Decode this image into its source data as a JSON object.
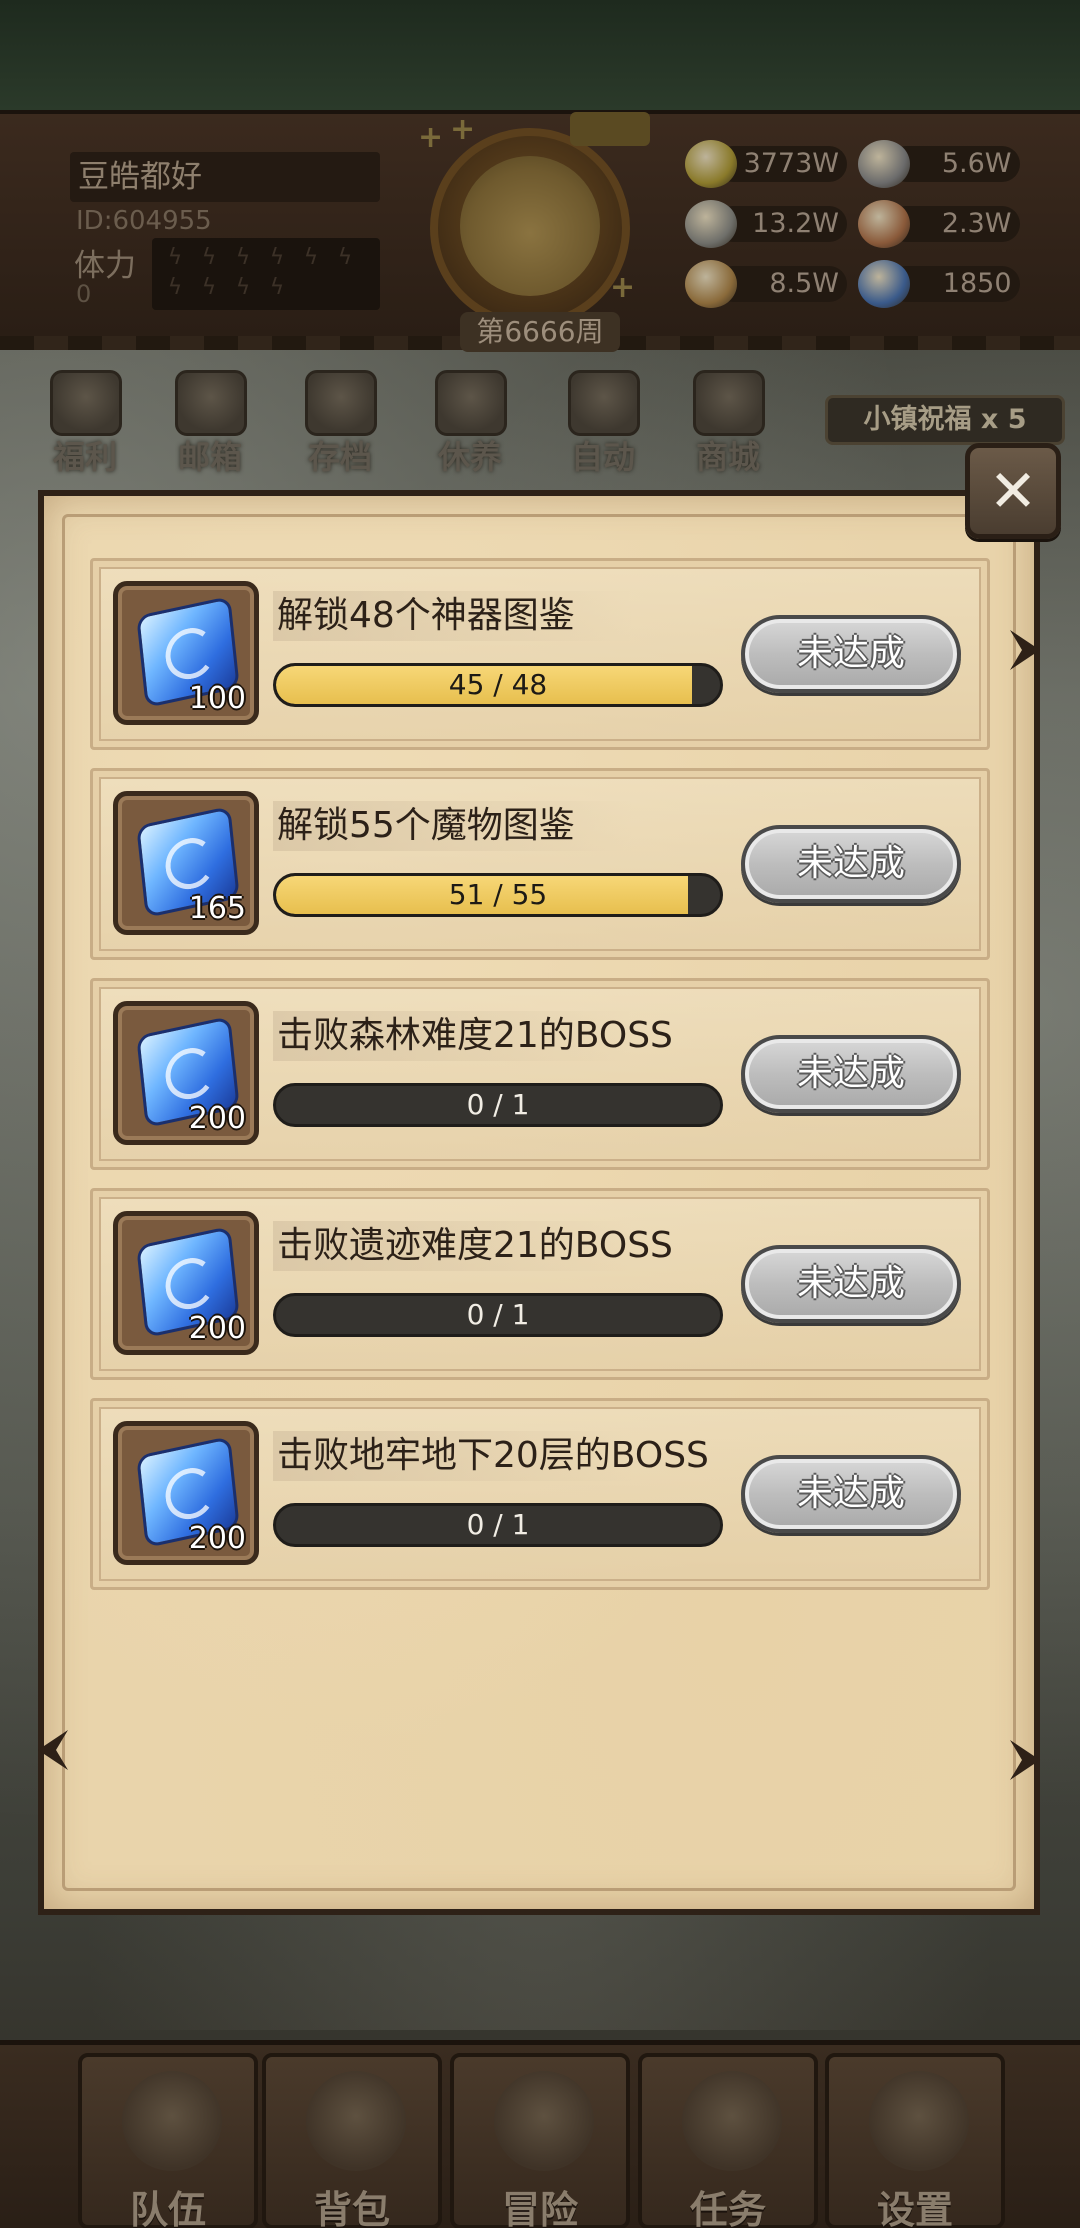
{
  "player": {
    "name": "豆皓都好",
    "id": "ID:604955",
    "stamina_label": "体力",
    "stamina_value": "0",
    "stamina_slots": 10,
    "badge": "",
    "week": "第6666周"
  },
  "resources": [
    {
      "icon": "gold-coin-icon",
      "value": "3773W",
      "color": "#8a7a2a"
    },
    {
      "icon": "iron-ingot-icon",
      "value": "5.6W",
      "color": "#6b6b6b"
    },
    {
      "icon": "ore-icon",
      "value": "13.2W",
      "color": "#6f6f6a"
    },
    {
      "icon": "leather-icon",
      "value": "2.3W",
      "color": "#8a5a3a"
    },
    {
      "icon": "wood-icon",
      "value": "8.5W",
      "color": "#8a6a3a"
    },
    {
      "icon": "blue-crystal-icon",
      "value": "1850",
      "color": "#3a5a8a"
    }
  ],
  "menu": [
    {
      "name": "welfare",
      "label": "福利"
    },
    {
      "name": "mailbox",
      "label": "邮箱"
    },
    {
      "name": "save",
      "label": "存档"
    },
    {
      "name": "rest",
      "label": "休养"
    },
    {
      "name": "auto",
      "label": "自动"
    },
    {
      "name": "shop",
      "label": "商城"
    }
  ],
  "blessing": "小镇祝福 x 5",
  "tasks": [
    {
      "title": "解锁48个神器图鉴",
      "reward": "100",
      "progress_text": "45 / 48",
      "progress": 0.9375,
      "status": "未达成"
    },
    {
      "title": "解锁55个魔物图鉴",
      "reward": "165",
      "progress_text": "51 / 55",
      "progress": 0.9273,
      "status": "未达成"
    },
    {
      "title": "击败森林难度21的BOSS",
      "reward": "200",
      "progress_text": "0 / 1",
      "progress": 0,
      "status": "未达成"
    },
    {
      "title": "击败遗迹难度21的BOSS",
      "reward": "200",
      "progress_text": "0 / 1",
      "progress": 0,
      "status": "未达成"
    },
    {
      "title": "击败地牢地下20层的BOSS",
      "reward": "200",
      "progress_text": "0 / 1",
      "progress": 0,
      "status": "未达成"
    }
  ],
  "bottom_nav": [
    {
      "name": "team",
      "label": "队伍"
    },
    {
      "name": "bag",
      "label": "背包"
    },
    {
      "name": "adventure",
      "label": "冒险"
    },
    {
      "name": "quest",
      "label": "任务"
    },
    {
      "name": "settings",
      "label": "设置"
    }
  ]
}
